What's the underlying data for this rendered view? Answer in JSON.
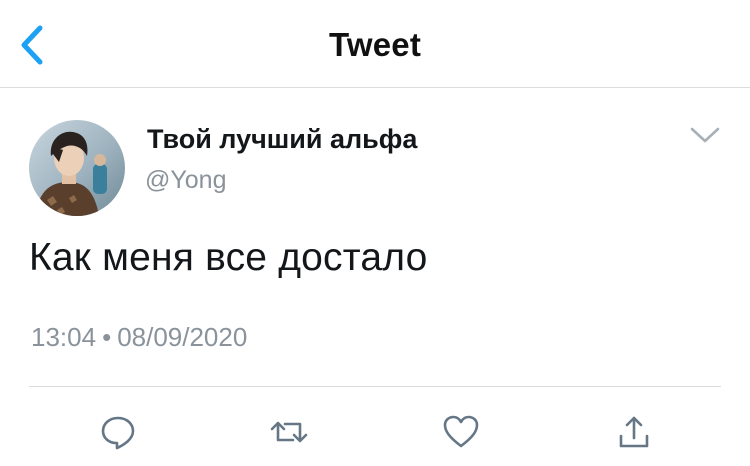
{
  "header": {
    "title": "Tweet",
    "back_icon": "chevron-left-icon"
  },
  "tweet": {
    "display_name": "Твой лучший альфа",
    "handle": "@Yong",
    "text": "Как меня все достало",
    "time": "13:04",
    "separator": "•",
    "date": "08/09/2020"
  },
  "actions": [
    "reply-icon",
    "retweet-icon",
    "like-icon",
    "share-icon"
  ],
  "colors": {
    "accent": "#1da1f2",
    "secondary_text": "#8a939b",
    "divider": "#dcdcdc",
    "icon": "#657786"
  }
}
